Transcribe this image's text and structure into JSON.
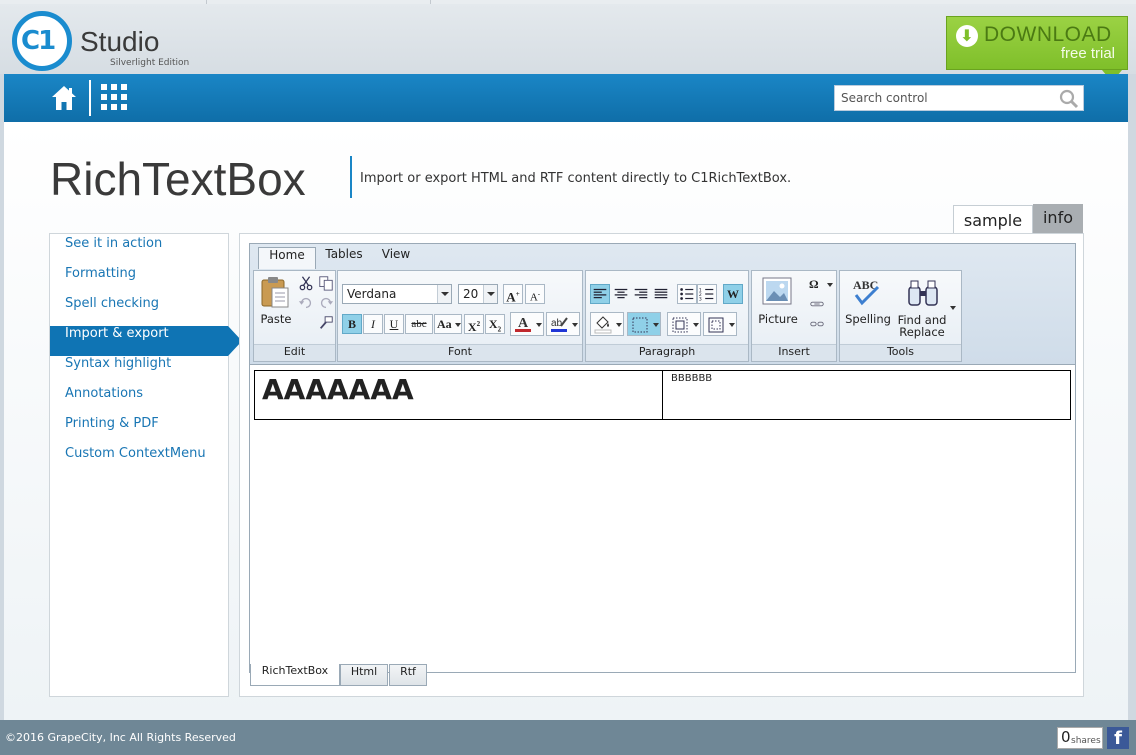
{
  "brand": {
    "logo_mark": "C1",
    "name": "Studio",
    "edition": "Silverlight Edition"
  },
  "download": {
    "main": "DOWNLOAD",
    "sub": "free trial",
    "color": "#7fbf2a"
  },
  "nav": {
    "home_icon": "home-icon",
    "grid_icon": "apps-grid-icon",
    "search_placeholder": "Search control",
    "accent": "#1a86c6"
  },
  "page": {
    "title": "RichTextBox",
    "description": "Import or export HTML and RTF content directly to C1RichTextBox."
  },
  "view_tabs": {
    "sample": "sample",
    "info": "info"
  },
  "sidebar": {
    "items": [
      {
        "label": "See it in action"
      },
      {
        "label": "Formatting"
      },
      {
        "label": "Spell checking"
      },
      {
        "label": "Import & export",
        "active": true
      },
      {
        "label": "Syntax highlight"
      },
      {
        "label": "Annotations"
      },
      {
        "label": "Printing & PDF"
      },
      {
        "label": "Custom ContextMenu"
      }
    ]
  },
  "ribbon": {
    "tabs": [
      "Home",
      "Tables",
      "View"
    ],
    "active_tab": "Home",
    "groups": {
      "edit": {
        "label": "Edit",
        "paste": "Paste"
      },
      "font": {
        "label": "Font",
        "family": "Verdana",
        "size": "20",
        "case_btn": "Aa",
        "bold": "B",
        "italic": "I",
        "underline": "U",
        "strike": "abc"
      },
      "paragraph": {
        "label": "Paragraph"
      },
      "insert": {
        "label": "Insert",
        "picture": "Picture",
        "symbol": "Ω"
      },
      "tools": {
        "label": "Tools",
        "spelling": "Spelling",
        "spelling_icon_text": "ABC",
        "find_replace_1": "Find and",
        "find_replace_2": "Replace"
      }
    }
  },
  "document": {
    "cell1": "AAAAAAA",
    "cell2": "BBBBBB"
  },
  "bottom_tabs": [
    "RichTextBox",
    "Html",
    "Rtf"
  ],
  "footer": {
    "copyright": "©2016 GrapeCity, Inc All Rights Reserved",
    "shares_count": "0",
    "shares_label": "shares",
    "fb": "f"
  }
}
